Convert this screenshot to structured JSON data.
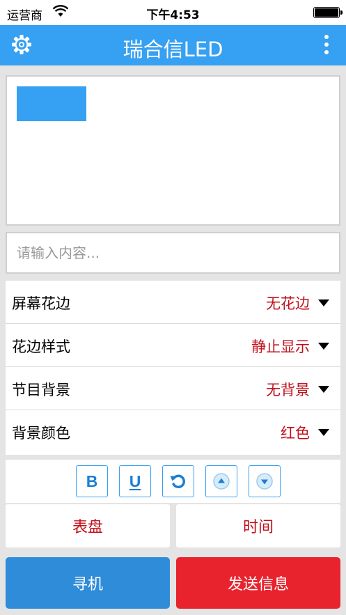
{
  "status_bar": {
    "carrier": "运营商",
    "time": "下午4:53"
  },
  "nav": {
    "title": "瑞合信LED",
    "left_icon": "gear-icon",
    "right_icon": "more-vertical-icon"
  },
  "preview": {
    "block_color": "#36a0f2"
  },
  "input": {
    "value": "",
    "placeholder": "请输入内容..."
  },
  "settings": [
    {
      "label": "屏幕花边",
      "value": "无花边"
    },
    {
      "label": "花边样式",
      "value": "静止显示"
    },
    {
      "label": "节目背景",
      "value": "无背景"
    },
    {
      "label": "背景颜色",
      "value": "红色"
    }
  ],
  "toolbar": {
    "bold_label": "B",
    "underline_label": "U",
    "icons": [
      "bold-icon",
      "underline-icon",
      "rotate-icon",
      "arrow-up-icon",
      "arrow-down-icon"
    ]
  },
  "function_buttons": {
    "dial_label": "表盘",
    "time_label": "时间"
  },
  "action_buttons": {
    "find_label": "寻机",
    "send_label": "发送信息"
  },
  "colors": {
    "accent": "#36a0f2",
    "value_red": "#c0101c",
    "find_button": "#2f8cd9",
    "send_button": "#e8232d"
  }
}
